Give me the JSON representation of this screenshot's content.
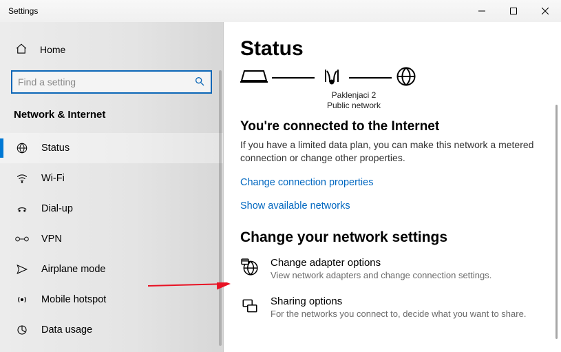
{
  "window": {
    "title": "Settings"
  },
  "sidebar": {
    "home_label": "Home",
    "search_placeholder": "Find a setting",
    "category": "Network & Internet",
    "items": [
      {
        "label": "Status",
        "icon": "status",
        "selected": true
      },
      {
        "label": "Wi-Fi",
        "icon": "wifi",
        "selected": false
      },
      {
        "label": "Dial-up",
        "icon": "dialup",
        "selected": false
      },
      {
        "label": "VPN",
        "icon": "vpn",
        "selected": false
      },
      {
        "label": "Airplane mode",
        "icon": "airplane",
        "selected": false
      },
      {
        "label": "Mobile hotspot",
        "icon": "hotspot",
        "selected": false
      },
      {
        "label": "Data usage",
        "icon": "data",
        "selected": false
      }
    ]
  },
  "main": {
    "title": "Status",
    "network_name": "Paklenjaci 2",
    "network_type": "Public network",
    "connected_heading": "You're connected to the Internet",
    "connected_body": "If you have a limited data plan, you can make this network a metered connection or change other properties.",
    "link_change_props": "Change connection properties",
    "link_show_networks": "Show available networks",
    "section_heading": "Change your network settings",
    "options": [
      {
        "title": "Change adapter options",
        "desc": "View network adapters and change connection settings.",
        "icon": "globe"
      },
      {
        "title": "Sharing options",
        "desc": "For the networks you connect to, decide what you want to share.",
        "icon": "share"
      }
    ]
  }
}
